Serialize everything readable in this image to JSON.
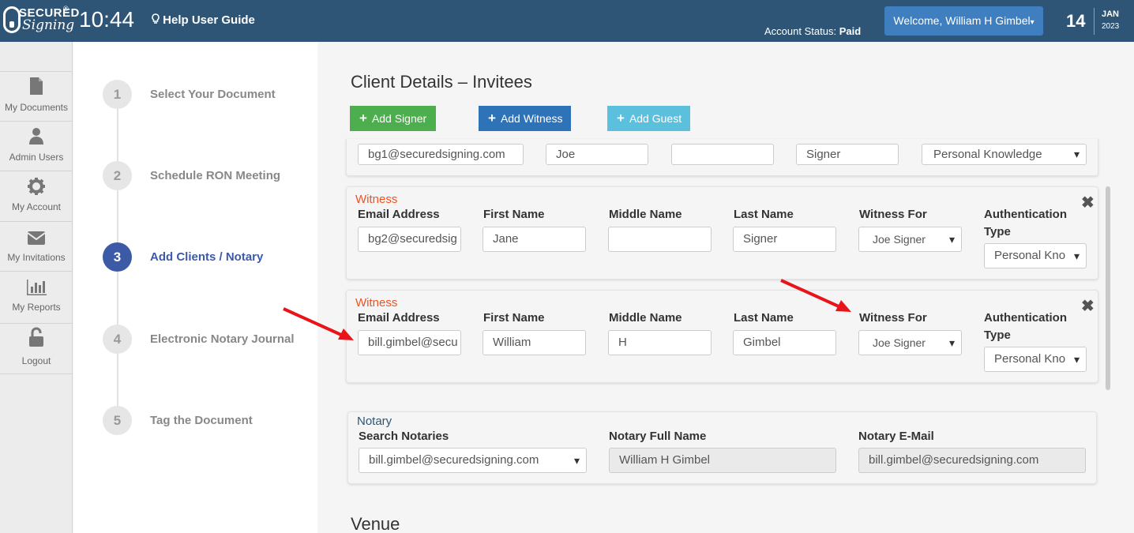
{
  "header": {
    "logo_text": "SECURED",
    "logo_script": "Signing",
    "time": "10:44",
    "help_label": "Help User Guide",
    "account_status_label": "Account Status:",
    "account_status_value": "Paid",
    "welcome": "Welcome,  William H Gimbel",
    "date_day": "14",
    "date_month": "JAN",
    "date_year": "2023"
  },
  "sidebar": {
    "items": [
      {
        "label": "My Documents",
        "icon": "document-icon"
      },
      {
        "label": "Admin Users",
        "icon": "user-icon"
      },
      {
        "label": "My Account",
        "icon": "gear-icon"
      },
      {
        "label": "My Invitations",
        "icon": "envelope-icon"
      },
      {
        "label": "My Reports",
        "icon": "bar-chart-icon"
      },
      {
        "label": "Logout",
        "icon": "unlock-icon"
      }
    ]
  },
  "steps": [
    {
      "num": "1",
      "label": "Select Your Document"
    },
    {
      "num": "2",
      "label": "Schedule RON Meeting"
    },
    {
      "num": "3",
      "label": "Add Clients / Notary",
      "active": true
    },
    {
      "num": "4",
      "label": "Electronic Notary Journal"
    },
    {
      "num": "5",
      "label": "Tag the Document"
    }
  ],
  "main": {
    "title": "Client Details – Invitees",
    "buttons": {
      "add_signer": "Add Signer",
      "add_witness": "Add Witness",
      "add_guest": "Add Guest"
    },
    "signer_row": {
      "email": "bg1@securedsigning.com",
      "first": "Joe",
      "middle": "",
      "last": "Signer",
      "auth": "Personal Knowledge"
    },
    "labels": {
      "witness": "Witness",
      "email": "Email Address",
      "first": "First Name",
      "middle": "Middle Name",
      "last": "Last Name",
      "witness_for": "Witness For",
      "auth": "Authentication",
      "auth2": "Type",
      "close": "✖"
    },
    "witness1": {
      "email": "bg2@securedsig",
      "first": "Jane",
      "middle": "",
      "last": "Signer",
      "witness_for": "Joe Signer",
      "auth": "Personal Kno"
    },
    "witness2": {
      "email": "bill.gimbel@secu",
      "first": "William",
      "middle": "H",
      "last": "Gimbel",
      "witness_for": "Joe Signer",
      "auth": "Personal Kno"
    },
    "notary": {
      "section": "Notary",
      "search_label": "Search Notaries",
      "search_value": "bill.gimbel@securedsigning.com",
      "name_label": "Notary Full Name",
      "name_value": "William H Gimbel",
      "email_label": "Notary E-Mail",
      "email_value": "bill.gimbel@securedsigning.com"
    },
    "venue": "Venue"
  },
  "colors": {
    "header_bg": "#2e5575",
    "active_step": "#3c5aa6",
    "signer_btn": "#4cae4c",
    "witness_btn": "#2e73b8",
    "guest_btn": "#5bc0de",
    "section_orange": "#f4511e",
    "arrow_red": "#e8141a"
  }
}
